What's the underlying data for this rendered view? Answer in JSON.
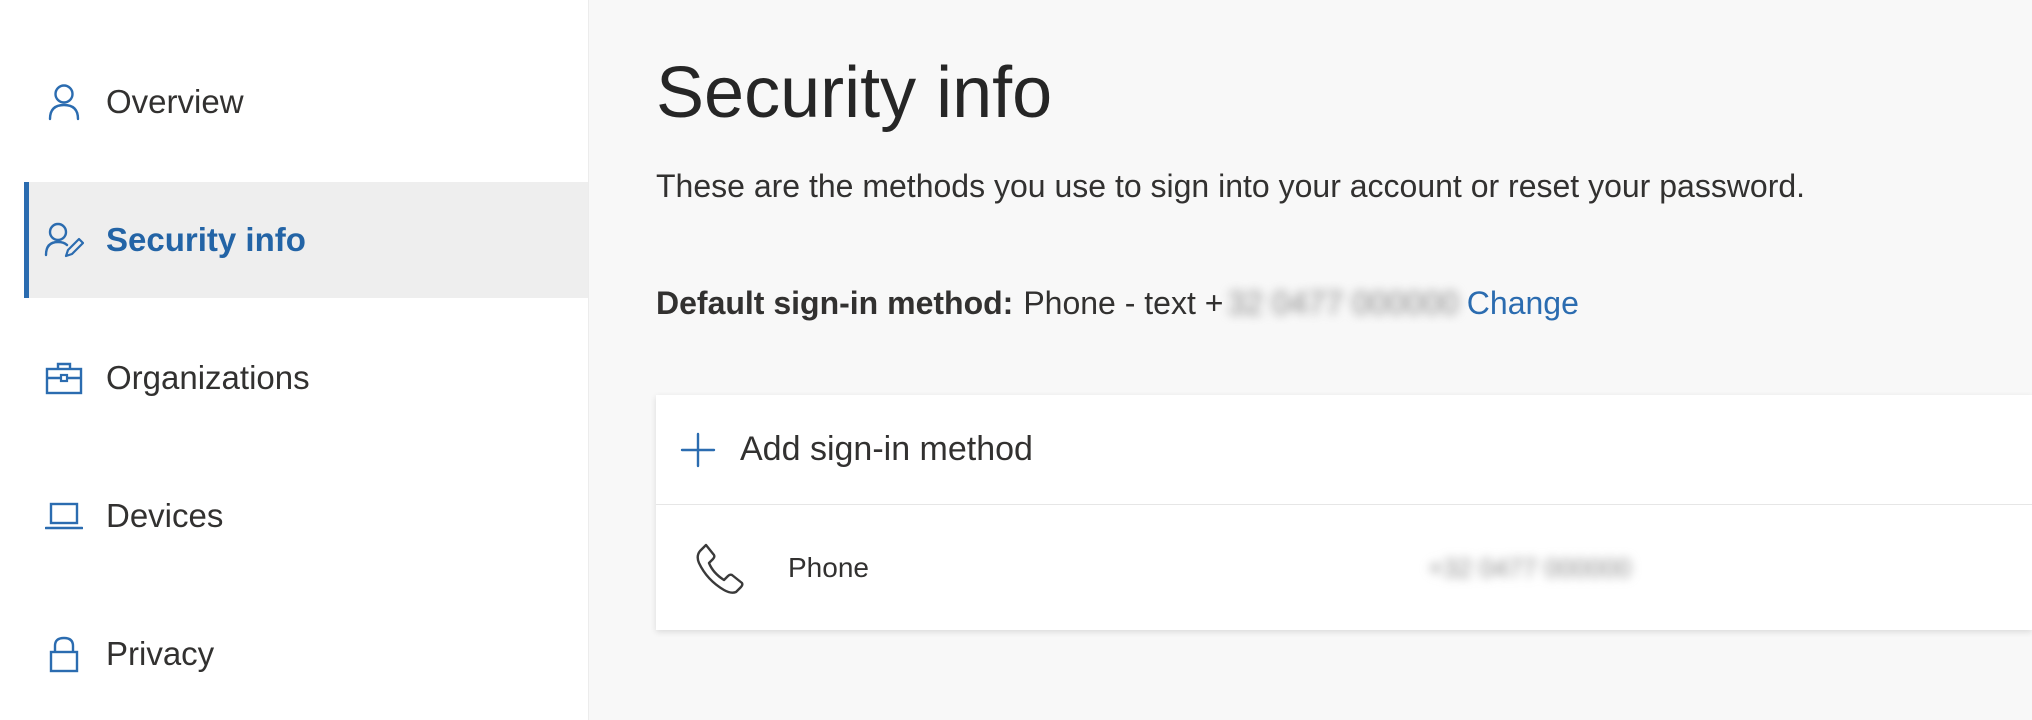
{
  "sidebar": {
    "items": [
      {
        "label": "Overview",
        "icon": "person-icon"
      },
      {
        "label": "Security info",
        "icon": "person-pen-icon",
        "active": true
      },
      {
        "label": "Organizations",
        "icon": "briefcase-icon"
      },
      {
        "label": "Devices",
        "icon": "laptop-icon"
      },
      {
        "label": "Privacy",
        "icon": "lock-icon"
      }
    ]
  },
  "main": {
    "title": "Security info",
    "description": "These are the methods you use to sign into your account or reset your password.",
    "default_method": {
      "label": "Default sign-in method:",
      "value": "Phone - text +",
      "masked": "32 0477 000000",
      "change_label": "Change"
    },
    "add_method_label": "Add sign-in method",
    "methods": [
      {
        "name": "Phone",
        "value": "+32 0477 000000",
        "icon": "phone-icon"
      }
    ]
  },
  "colors": {
    "accent": "#2b6cb0",
    "active_bg": "#eeeeee",
    "page_bg": "#f8f8f8"
  }
}
